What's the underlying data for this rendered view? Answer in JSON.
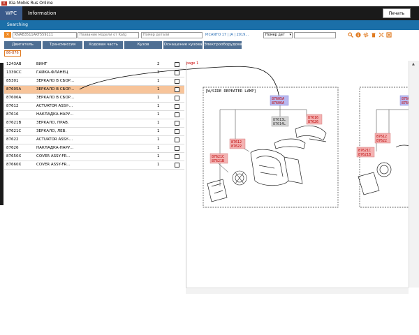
{
  "window": {
    "title": "Kia Mobis Rus Online"
  },
  "menu": {
    "tabs": [
      {
        "label": "WPC"
      },
      {
        "label": "Information"
      }
    ],
    "print_label": "Печать"
  },
  "searching": {
    "label": "Searching"
  },
  "toolbar": {
    "vin_value": "KNAB3511AKT559111",
    "catalog_placeholder": "Название модели от Katg",
    "part_number_placeholder": "Номер детали",
    "model_link": "PICANTO 17 | JA | 2019...",
    "select_value": "Номер дет",
    "icons": [
      "search-icon",
      "info-icon",
      "settings-icon",
      "trash-icon",
      "collapse-icon",
      "expand-icon"
    ]
  },
  "categories": [
    {
      "label": "Двигатель"
    },
    {
      "label": "Трансмиссия"
    },
    {
      "label": "Ходовая часть"
    },
    {
      "label": "Кузов"
    },
    {
      "label": "Оснащение кузова"
    },
    {
      "label": "Электрооборудован"
    }
  ],
  "group_code": "86-876",
  "parts": [
    {
      "number": "1243AB",
      "name": "ВИНТ",
      "qty": "2",
      "selected": false
    },
    {
      "number": "1339CC",
      "name": "ГАЙКА-ФЛАНЕЦ",
      "qty": "3",
      "selected": false
    },
    {
      "number": "85301",
      "name": "ЗЕРКАЛО В СБОР...",
      "qty": "1",
      "selected": false
    },
    {
      "number": "87605A",
      "name": "ЗЕРКАЛО В СБОР...",
      "qty": "1",
      "selected": true
    },
    {
      "number": "87606A",
      "name": "ЗЕРКАЛО В СБОР...",
      "qty": "1",
      "selected": false
    },
    {
      "number": "87612",
      "name": "ACTUATOR ASSY-...",
      "qty": "1",
      "selected": false
    },
    {
      "number": "87616",
      "name": "НАКЛАДКА-НАРУ...",
      "qty": "1",
      "selected": false
    },
    {
      "number": "87621B",
      "name": "ЗЕРКАЛО, ПРАВ.",
      "qty": "1",
      "selected": false
    },
    {
      "number": "87621C",
      "name": "ЗЕРКАЛО, ЛЕВ.",
      "qty": "1",
      "selected": false
    },
    {
      "number": "87622",
      "name": "ACTUATOR ASSY-...",
      "qty": "1",
      "selected": false
    },
    {
      "number": "87626",
      "name": "НАКЛАДКА-НАРУ...",
      "qty": "1",
      "selected": false
    },
    {
      "number": "87650X",
      "name": "COVER ASSY-FR...",
      "qty": "1",
      "selected": false
    },
    {
      "number": "87660X",
      "name": "COVER ASSY-FR...",
      "qty": "1",
      "selected": false
    }
  ],
  "diagram": {
    "page_label": "page 1",
    "caption": "[W/SIDE REPEATER LAMP]",
    "callouts": {
      "main_top": [
        "87605A",
        "87606A"
      ],
      "lamp_a": [
        "87613L",
        "87614L"
      ],
      "lamp_b": [
        "87616",
        "87626"
      ],
      "actuator": [
        "87612",
        "87622"
      ],
      "glass": [
        "87621C",
        "87621B"
      ],
      "right_actuator": [
        "87612",
        "87622"
      ],
      "right_glass": [
        "87621C",
        "87621B"
      ],
      "right_top": [
        "8760",
        "8760"
      ]
    }
  },
  "colors": {
    "menubar": "#1a1a1a",
    "active_tab": "#3a5a8a",
    "searchbar": "#1b6fa8",
    "category": "#4f6f93",
    "selected_row": "#f7c49a",
    "callout_red": "#f4b3b3",
    "callout_blue": "#b9b9f0",
    "callout_gray": "#d6d6d6"
  }
}
